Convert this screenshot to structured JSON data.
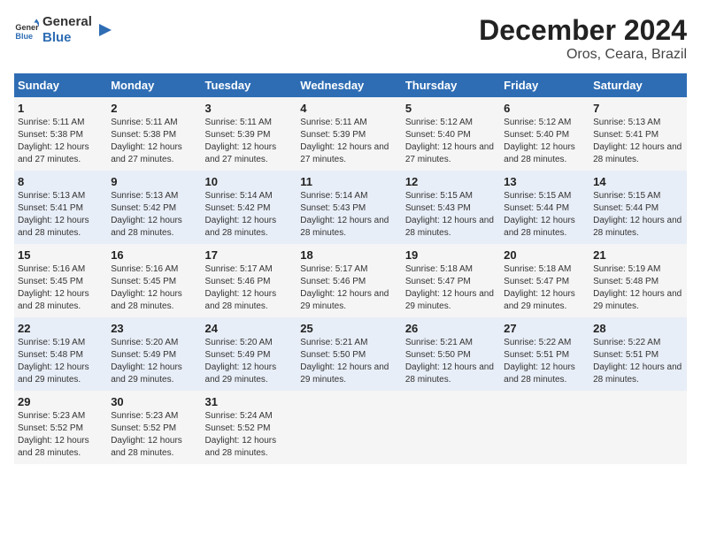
{
  "logo": {
    "line1": "General",
    "line2": "Blue"
  },
  "title": "December 2024",
  "subtitle": "Oros, Ceara, Brazil",
  "weekdays": [
    "Sunday",
    "Monday",
    "Tuesday",
    "Wednesday",
    "Thursday",
    "Friday",
    "Saturday"
  ],
  "weeks": [
    [
      {
        "day": "1",
        "sunrise": "5:11 AM",
        "sunset": "5:38 PM",
        "daylight": "12 hours and 27 minutes."
      },
      {
        "day": "2",
        "sunrise": "5:11 AM",
        "sunset": "5:38 PM",
        "daylight": "12 hours and 27 minutes."
      },
      {
        "day": "3",
        "sunrise": "5:11 AM",
        "sunset": "5:39 PM",
        "daylight": "12 hours and 27 minutes."
      },
      {
        "day": "4",
        "sunrise": "5:11 AM",
        "sunset": "5:39 PM",
        "daylight": "12 hours and 27 minutes."
      },
      {
        "day": "5",
        "sunrise": "5:12 AM",
        "sunset": "5:40 PM",
        "daylight": "12 hours and 27 minutes."
      },
      {
        "day": "6",
        "sunrise": "5:12 AM",
        "sunset": "5:40 PM",
        "daylight": "12 hours and 28 minutes."
      },
      {
        "day": "7",
        "sunrise": "5:13 AM",
        "sunset": "5:41 PM",
        "daylight": "12 hours and 28 minutes."
      }
    ],
    [
      {
        "day": "8",
        "sunrise": "5:13 AM",
        "sunset": "5:41 PM",
        "daylight": "12 hours and 28 minutes."
      },
      {
        "day": "9",
        "sunrise": "5:13 AM",
        "sunset": "5:42 PM",
        "daylight": "12 hours and 28 minutes."
      },
      {
        "day": "10",
        "sunrise": "5:14 AM",
        "sunset": "5:42 PM",
        "daylight": "12 hours and 28 minutes."
      },
      {
        "day": "11",
        "sunrise": "5:14 AM",
        "sunset": "5:43 PM",
        "daylight": "12 hours and 28 minutes."
      },
      {
        "day": "12",
        "sunrise": "5:15 AM",
        "sunset": "5:43 PM",
        "daylight": "12 hours and 28 minutes."
      },
      {
        "day": "13",
        "sunrise": "5:15 AM",
        "sunset": "5:44 PM",
        "daylight": "12 hours and 28 minutes."
      },
      {
        "day": "14",
        "sunrise": "5:15 AM",
        "sunset": "5:44 PM",
        "daylight": "12 hours and 28 minutes."
      }
    ],
    [
      {
        "day": "15",
        "sunrise": "5:16 AM",
        "sunset": "5:45 PM",
        "daylight": "12 hours and 28 minutes."
      },
      {
        "day": "16",
        "sunrise": "5:16 AM",
        "sunset": "5:45 PM",
        "daylight": "12 hours and 28 minutes."
      },
      {
        "day": "17",
        "sunrise": "5:17 AM",
        "sunset": "5:46 PM",
        "daylight": "12 hours and 28 minutes."
      },
      {
        "day": "18",
        "sunrise": "5:17 AM",
        "sunset": "5:46 PM",
        "daylight": "12 hours and 29 minutes."
      },
      {
        "day": "19",
        "sunrise": "5:18 AM",
        "sunset": "5:47 PM",
        "daylight": "12 hours and 29 minutes."
      },
      {
        "day": "20",
        "sunrise": "5:18 AM",
        "sunset": "5:47 PM",
        "daylight": "12 hours and 29 minutes."
      },
      {
        "day": "21",
        "sunrise": "5:19 AM",
        "sunset": "5:48 PM",
        "daylight": "12 hours and 29 minutes."
      }
    ],
    [
      {
        "day": "22",
        "sunrise": "5:19 AM",
        "sunset": "5:48 PM",
        "daylight": "12 hours and 29 minutes."
      },
      {
        "day": "23",
        "sunrise": "5:20 AM",
        "sunset": "5:49 PM",
        "daylight": "12 hours and 29 minutes."
      },
      {
        "day": "24",
        "sunrise": "5:20 AM",
        "sunset": "5:49 PM",
        "daylight": "12 hours and 29 minutes."
      },
      {
        "day": "25",
        "sunrise": "5:21 AM",
        "sunset": "5:50 PM",
        "daylight": "12 hours and 29 minutes."
      },
      {
        "day": "26",
        "sunrise": "5:21 AM",
        "sunset": "5:50 PM",
        "daylight": "12 hours and 28 minutes."
      },
      {
        "day": "27",
        "sunrise": "5:22 AM",
        "sunset": "5:51 PM",
        "daylight": "12 hours and 28 minutes."
      },
      {
        "day": "28",
        "sunrise": "5:22 AM",
        "sunset": "5:51 PM",
        "daylight": "12 hours and 28 minutes."
      }
    ],
    [
      {
        "day": "29",
        "sunrise": "5:23 AM",
        "sunset": "5:52 PM",
        "daylight": "12 hours and 28 minutes."
      },
      {
        "day": "30",
        "sunrise": "5:23 AM",
        "sunset": "5:52 PM",
        "daylight": "12 hours and 28 minutes."
      },
      {
        "day": "31",
        "sunrise": "5:24 AM",
        "sunset": "5:52 PM",
        "daylight": "12 hours and 28 minutes."
      },
      null,
      null,
      null,
      null
    ]
  ],
  "labels": {
    "sunrise": "Sunrise:",
    "sunset": "Sunset:",
    "daylight": "Daylight:"
  }
}
